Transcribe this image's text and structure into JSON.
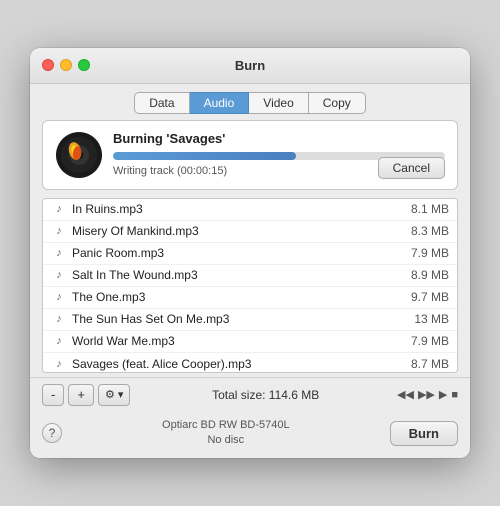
{
  "window": {
    "title": "Burn"
  },
  "tabs": [
    {
      "id": "data",
      "label": "Data",
      "active": false
    },
    {
      "id": "audio",
      "label": "Audio",
      "active": true
    },
    {
      "id": "video",
      "label": "Video",
      "active": false
    },
    {
      "id": "copy",
      "label": "Copy",
      "active": false
    }
  ],
  "burn_progress": {
    "title": "Burning 'Savages'",
    "status": "Writing track (00:00:15)",
    "progress_pct": 55,
    "cancel_label": "Cancel"
  },
  "files": [
    {
      "name": "In Ruins.mp3",
      "size": "8.1 MB"
    },
    {
      "name": "Misery Of Mankind.mp3",
      "size": "8.3 MB"
    },
    {
      "name": "Panic Room.mp3",
      "size": "7.9 MB"
    },
    {
      "name": "Salt In The Wound.mp3",
      "size": "8.9 MB"
    },
    {
      "name": "The One.mp3",
      "size": "9.7 MB"
    },
    {
      "name": "The Sun Has Set On Me.mp3",
      "size": "13 MB"
    },
    {
      "name": "World War Me.mp3",
      "size": "7.9 MB"
    },
    {
      "name": "Savages (feat. Alice Cooper).mp3",
      "size": "8.7 MB"
    }
  ],
  "toolbar": {
    "minus_label": "-",
    "plus_label": "+",
    "gear_label": "⚙",
    "chevron_label": "▾",
    "total_size": "Total size: 114.6 MB"
  },
  "playback": {
    "prev_label": "◀◀",
    "next_label": "▶▶",
    "play_label": "▶",
    "stop_label": "■"
  },
  "bottom": {
    "help_label": "?",
    "device_line1": "Optiarc BD RW BD-5740L",
    "device_line2": "No disc",
    "burn_label": "Burn"
  }
}
